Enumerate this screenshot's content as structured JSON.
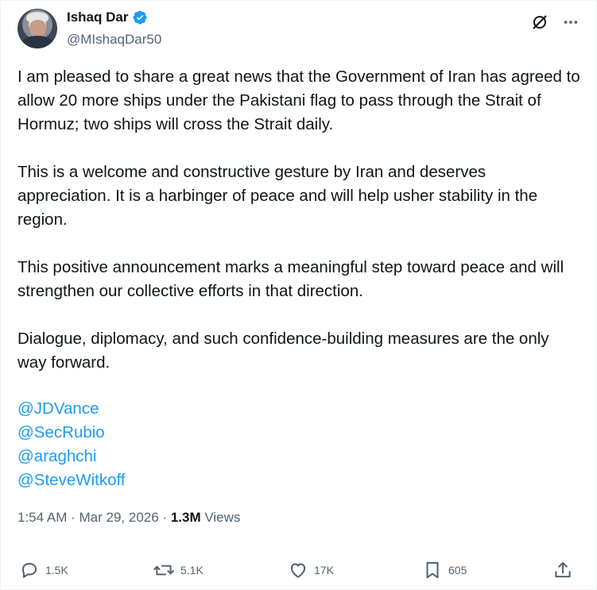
{
  "author": {
    "name": "Ishaq Dar",
    "handle": "@MIshaqDar50"
  },
  "post": {
    "paragraphs": [
      "I am pleased to share a great news that the Government of Iran has agreed to allow 20 more ships under the Pakistani flag to pass through the Strait of Hormuz; two ships will cross the Strait daily.",
      "This is a welcome and constructive gesture by Iran and deserves appreciation. It is a harbinger of peace and will help usher stability in the region.",
      "This positive announcement marks a meaningful step toward peace and will strengthen our collective efforts in that direction.",
      "Dialogue, diplomacy, and such confidence-building measures are the only way forward."
    ],
    "mentions": [
      "@JDVance",
      "@SecRubio",
      "@araghchi",
      "@SteveWitkoff"
    ]
  },
  "meta": {
    "time": "1:54 AM",
    "date": "Mar 29, 2026",
    "separator": "·",
    "views_count": "1.3M",
    "views_label": "Views"
  },
  "actions": {
    "replies": "1.5K",
    "reposts": "5.1K",
    "likes": "17K",
    "bookmarks": "605"
  },
  "colors": {
    "link": "#1d9bf0",
    "verified": "#1d9bf0",
    "secondary_text": "#536471",
    "primary_text": "#0f1419"
  },
  "icons": [
    "verified-badge-icon",
    "grok-icon",
    "more-icon",
    "reply-icon",
    "repost-icon",
    "like-icon",
    "bookmark-icon",
    "share-icon"
  ]
}
